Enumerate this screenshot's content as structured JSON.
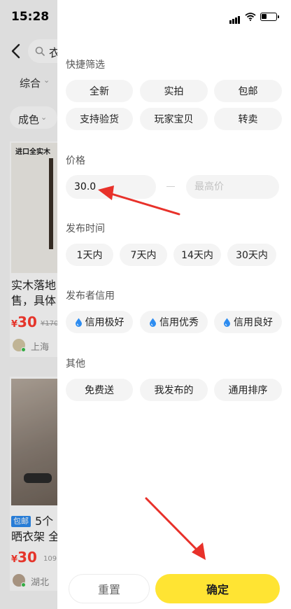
{
  "status_bar": {
    "time": "15:28"
  },
  "background": {
    "search_text": "衣",
    "sort_label": "综合",
    "color_filter_label": "成色",
    "image_brand_text": "进口全实木",
    "item1": {
      "title_line1": "实木落地",
      "title_line2": "售，具体",
      "price_symbol": "¥",
      "price": "30",
      "old_price": "¥170",
      "location": "上海"
    },
    "item2": {
      "tag": "包邮",
      "title_line1": "5个",
      "title_line2": "晒衣架 全",
      "price_symbol": "¥",
      "price": "30",
      "want_count": "109",
      "location": "湖北"
    }
  },
  "filter": {
    "quick": {
      "title": "快捷筛选",
      "options": [
        "全新",
        "实拍",
        "包邮",
        "支持验货",
        "玩家宝贝",
        "转卖"
      ]
    },
    "price": {
      "title": "价格",
      "min_value": "30.0",
      "max_placeholder": "最高价"
    },
    "publish_time": {
      "title": "发布时间",
      "options": [
        "1天内",
        "7天内",
        "14天内",
        "30天内"
      ]
    },
    "credit": {
      "title": "发布者信用",
      "options": [
        "信用极好",
        "信用优秀",
        "信用良好"
      ]
    },
    "other": {
      "title": "其他",
      "options": [
        "免费送",
        "我发布的",
        "通用排序"
      ]
    },
    "reset_label": "重置",
    "confirm_label": "确定"
  },
  "colors": {
    "accent_yellow": "#ffe433",
    "price_red": "#ff3b30",
    "annotation_arrow": "#e8312a",
    "credit_drop_blue": "#2d8cf0"
  }
}
